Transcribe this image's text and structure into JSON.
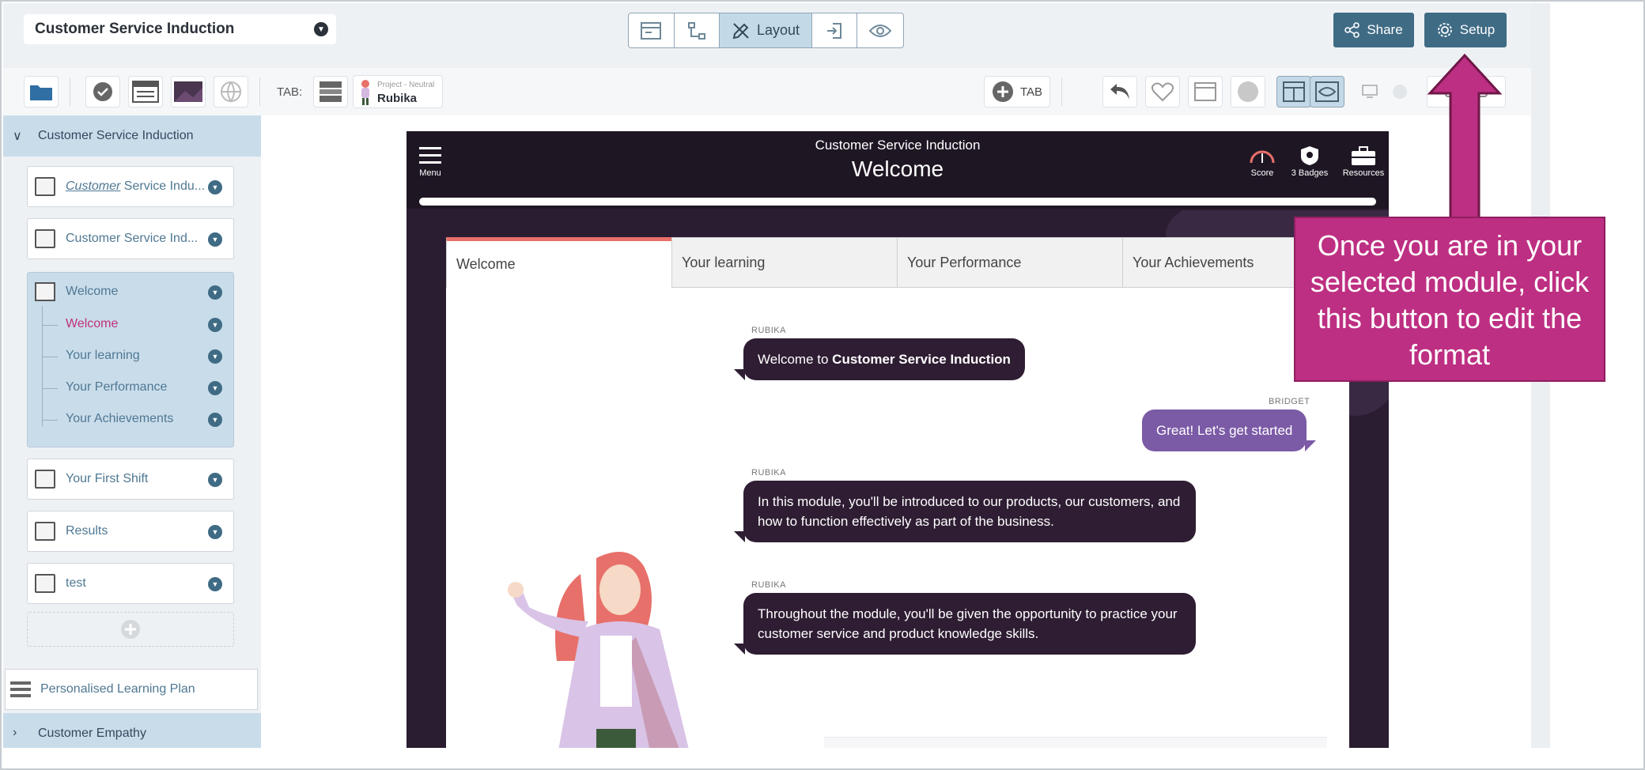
{
  "topbar": {
    "module_select": "Customer Service Induction",
    "layout_label": "Layout",
    "share_label": "Share",
    "setup_label": "Setup"
  },
  "toolbar": {
    "tab_label": "TAB:",
    "character_role": "Project - Neutral",
    "character_name": "Rubika",
    "add_tab_label": "TAB"
  },
  "sidebar": {
    "section_open": "Customer Service Induction",
    "card1_italic": "Customer",
    "card1_rest": " Service Indu...",
    "card2": "Customer Service Ind...",
    "group_title": "Welcome",
    "group_items": [
      "Welcome",
      "Your learning",
      "Your Performance",
      "Your Achievements"
    ],
    "card_first_shift": "Your First Shift",
    "card_results": "Results",
    "card_test": "test",
    "plan": "Personalised Learning Plan",
    "section_closed": "Customer Empathy"
  },
  "preview": {
    "module_title": "Customer Service Induction",
    "screen_title": "Welcome",
    "menu_label": "Menu",
    "score_label": "Score",
    "badges_label": "3 Badges",
    "resources_label": "Resources",
    "tabs": [
      "Welcome",
      "Your learning",
      "Your Performance",
      "Your Achievements"
    ],
    "messages": {
      "m1_speaker": "RUBIKA",
      "m1_text_a": "Welcome to ",
      "m1_text_b": "Customer Service Induction",
      "m2_speaker": "BRIDGET",
      "m2_text": "Great! Let's get started",
      "m3_speaker": "RUBIKA",
      "m3_text": "In this module, you'll be introduced to our products, our customers, and how to function effectively as part of the business.",
      "m4_speaker": "RUBIKA",
      "m4_text": "Throughout the module, you'll be given the opportunity to practice your customer service and product knowledge skills."
    }
  },
  "callout": {
    "text": "Once you are in your selected module, click this button to edit the format"
  },
  "colors": {
    "accent": "#3f6b85",
    "callout": "#bd2f82",
    "preview_bg": "#2a1c31",
    "active_sub": "#c0307e"
  }
}
